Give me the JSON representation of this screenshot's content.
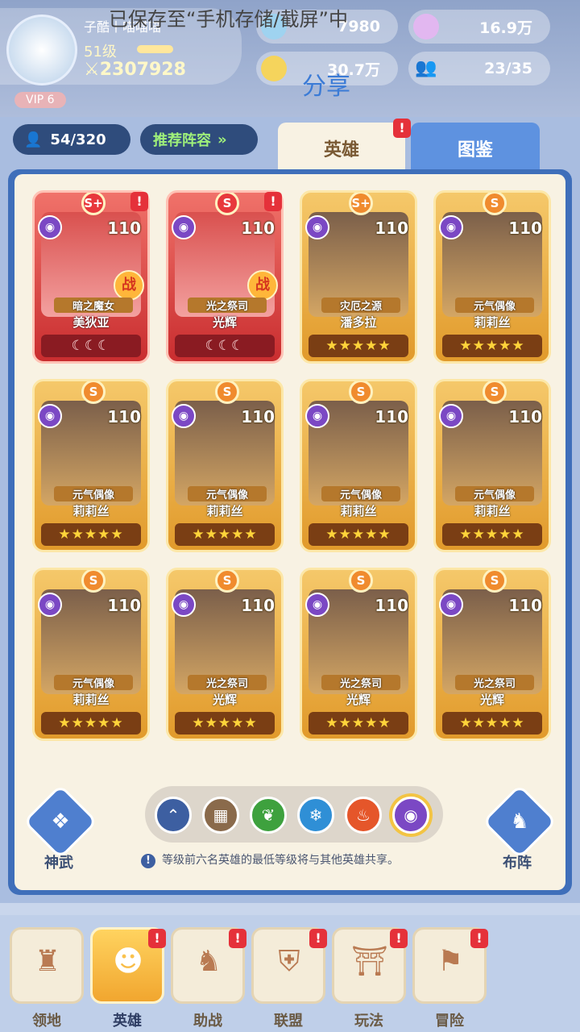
{
  "toast": "已保存至“手机存储/截屏”中",
  "share": "分享",
  "player": {
    "name": "子酷丨喵喵喵",
    "level": "51级",
    "power": "2307928",
    "vip": "VIP 6"
  },
  "resources": [
    {
      "value": "7980",
      "icon": "crystal-icon"
    },
    {
      "value": "16.9万",
      "icon": "ring-icon"
    },
    {
      "value": "30.7万",
      "icon": "gold-coin-icon"
    },
    {
      "value": "23/35",
      "icon": "friends-icon"
    }
  ],
  "hero_count": "54/320",
  "recommend": "推荐阵容",
  "tabs": {
    "heroes": "英雄",
    "codex": "图鉴"
  },
  "cards": [
    {
      "title": "暗之魔女",
      "name": "美狄亚",
      "level": "110",
      "style": "red",
      "stars": "☾☾☾",
      "rank": "S+",
      "war": "战",
      "alert": true
    },
    {
      "title": "光之祭司",
      "name": "光辉",
      "level": "110",
      "style": "red",
      "stars": "☾☾☾",
      "rank": "S",
      "war": "战",
      "alert": true
    },
    {
      "title": "灾厄之源",
      "name": "潘多拉",
      "level": "110",
      "style": "gold",
      "stars": "★★★★★",
      "rank": "S+",
      "war": "",
      "alert": false
    },
    {
      "title": "元气偶像",
      "name": "莉莉丝",
      "level": "110",
      "style": "gold",
      "stars": "★★★★★",
      "rank": "S",
      "war": "",
      "alert": false
    },
    {
      "title": "元气偶像",
      "name": "莉莉丝",
      "level": "110",
      "style": "gold",
      "stars": "★★★★★",
      "rank": "S",
      "war": "",
      "alert": false
    },
    {
      "title": "元气偶像",
      "name": "莉莉丝",
      "level": "110",
      "style": "gold",
      "stars": "★★★★★",
      "rank": "S",
      "war": "",
      "alert": false
    },
    {
      "title": "元气偶像",
      "name": "莉莉丝",
      "level": "110",
      "style": "gold",
      "stars": "★★★★★",
      "rank": "S",
      "war": "",
      "alert": false
    },
    {
      "title": "元气偶像",
      "name": "莉莉丝",
      "level": "110",
      "style": "gold",
      "stars": "★★★★★",
      "rank": "S",
      "war": "",
      "alert": false
    },
    {
      "title": "元气偶像",
      "name": "莉莉丝",
      "level": "110",
      "style": "gold",
      "stars": "★★★★★",
      "rank": "S",
      "war": "",
      "alert": false
    },
    {
      "title": "光之祭司",
      "name": "光辉",
      "level": "110",
      "style": "gold",
      "stars": "★★★★★",
      "rank": "S",
      "war": "",
      "alert": false
    },
    {
      "title": "光之祭司",
      "name": "光辉",
      "level": "110",
      "style": "gold",
      "stars": "★★★★★",
      "rank": "S",
      "war": "",
      "alert": false
    },
    {
      "title": "光之祭司",
      "name": "光辉",
      "level": "110",
      "style": "gold",
      "stars": "★★★★★",
      "rank": "S",
      "war": "",
      "alert": false
    }
  ],
  "filters": [
    {
      "icon": "all-icon",
      "glyph": "⌃",
      "color": "#3d5fa1"
    },
    {
      "icon": "grid-icon",
      "glyph": "▦",
      "color": "#8a6a4b"
    },
    {
      "icon": "nature-icon",
      "glyph": "❦",
      "color": "#3ea13e"
    },
    {
      "icon": "ice-icon",
      "glyph": "❄",
      "color": "#2f8fd6"
    },
    {
      "icon": "fire-icon",
      "glyph": "♨",
      "color": "#e5562a"
    },
    {
      "icon": "dark-icon",
      "glyph": "◉",
      "color": "#7b48c4"
    }
  ],
  "side": {
    "divine": "神武",
    "formation": "布阵"
  },
  "tip": "等级前六名英雄的最低等级将与其他英雄共享。",
  "nav": [
    {
      "label": "领地",
      "icon": "castle-icon",
      "glyph": "♜",
      "alert": false,
      "active": false
    },
    {
      "label": "英雄",
      "icon": "hero-icon",
      "glyph": "☻",
      "alert": true,
      "active": true
    },
    {
      "label": "助战",
      "icon": "assist-icon",
      "glyph": "♞",
      "alert": true,
      "active": false
    },
    {
      "label": "联盟",
      "icon": "alliance-icon",
      "glyph": "⛨",
      "alert": true,
      "active": false
    },
    {
      "label": "玩法",
      "icon": "gameplay-icon",
      "glyph": "⛩",
      "alert": true,
      "active": false
    },
    {
      "label": "冒险",
      "icon": "adventure-icon",
      "glyph": "⚑",
      "alert": true,
      "active": false
    }
  ]
}
